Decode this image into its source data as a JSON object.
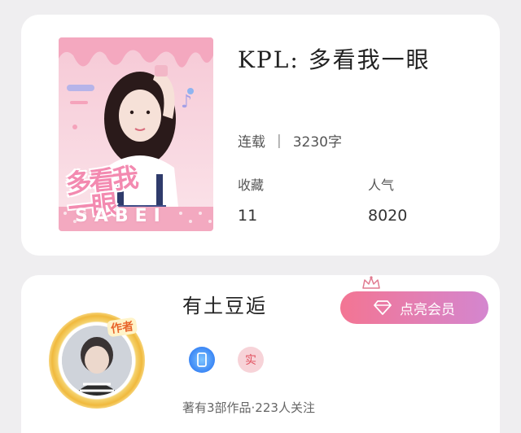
{
  "book": {
    "title": "KPL: 多看我一眼",
    "serial_status": "连载",
    "word_count": "3230字",
    "favorites_label": "收藏",
    "favorites_value": "11",
    "popularity_label": "人气",
    "popularity_value": "8020",
    "cover": {
      "title_art": "多看我一眼",
      "brand_text": "SABEI"
    }
  },
  "author": {
    "name": "有土豆逅",
    "tag": "作者",
    "vip_button": "点亮会员",
    "badge_real": "实",
    "meta": "著有3部作品·223人关注"
  },
  "colors": {
    "vip_gradient_start": "#f37593",
    "vip_gradient_end": "#d486cf",
    "background": "#efeef0"
  }
}
